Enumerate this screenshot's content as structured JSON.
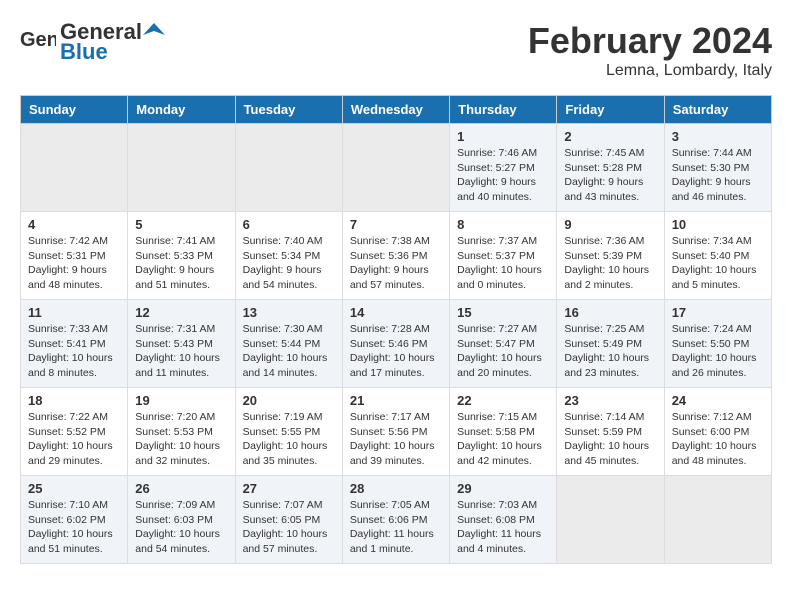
{
  "header": {
    "logo_general": "General",
    "logo_blue": "Blue",
    "month": "February 2024",
    "location": "Lemna, Lombardy, Italy"
  },
  "weekdays": [
    "Sunday",
    "Monday",
    "Tuesday",
    "Wednesday",
    "Thursday",
    "Friday",
    "Saturday"
  ],
  "weeks": [
    [
      {
        "day": "",
        "info": ""
      },
      {
        "day": "",
        "info": ""
      },
      {
        "day": "",
        "info": ""
      },
      {
        "day": "",
        "info": ""
      },
      {
        "day": "1",
        "info": "Sunrise: 7:46 AM\nSunset: 5:27 PM\nDaylight: 9 hours\nand 40 minutes."
      },
      {
        "day": "2",
        "info": "Sunrise: 7:45 AM\nSunset: 5:28 PM\nDaylight: 9 hours\nand 43 minutes."
      },
      {
        "day": "3",
        "info": "Sunrise: 7:44 AM\nSunset: 5:30 PM\nDaylight: 9 hours\nand 46 minutes."
      }
    ],
    [
      {
        "day": "4",
        "info": "Sunrise: 7:42 AM\nSunset: 5:31 PM\nDaylight: 9 hours\nand 48 minutes."
      },
      {
        "day": "5",
        "info": "Sunrise: 7:41 AM\nSunset: 5:33 PM\nDaylight: 9 hours\nand 51 minutes."
      },
      {
        "day": "6",
        "info": "Sunrise: 7:40 AM\nSunset: 5:34 PM\nDaylight: 9 hours\nand 54 minutes."
      },
      {
        "day": "7",
        "info": "Sunrise: 7:38 AM\nSunset: 5:36 PM\nDaylight: 9 hours\nand 57 minutes."
      },
      {
        "day": "8",
        "info": "Sunrise: 7:37 AM\nSunset: 5:37 PM\nDaylight: 10 hours\nand 0 minutes."
      },
      {
        "day": "9",
        "info": "Sunrise: 7:36 AM\nSunset: 5:39 PM\nDaylight: 10 hours\nand 2 minutes."
      },
      {
        "day": "10",
        "info": "Sunrise: 7:34 AM\nSunset: 5:40 PM\nDaylight: 10 hours\nand 5 minutes."
      }
    ],
    [
      {
        "day": "11",
        "info": "Sunrise: 7:33 AM\nSunset: 5:41 PM\nDaylight: 10 hours\nand 8 minutes."
      },
      {
        "day": "12",
        "info": "Sunrise: 7:31 AM\nSunset: 5:43 PM\nDaylight: 10 hours\nand 11 minutes."
      },
      {
        "day": "13",
        "info": "Sunrise: 7:30 AM\nSunset: 5:44 PM\nDaylight: 10 hours\nand 14 minutes."
      },
      {
        "day": "14",
        "info": "Sunrise: 7:28 AM\nSunset: 5:46 PM\nDaylight: 10 hours\nand 17 minutes."
      },
      {
        "day": "15",
        "info": "Sunrise: 7:27 AM\nSunset: 5:47 PM\nDaylight: 10 hours\nand 20 minutes."
      },
      {
        "day": "16",
        "info": "Sunrise: 7:25 AM\nSunset: 5:49 PM\nDaylight: 10 hours\nand 23 minutes."
      },
      {
        "day": "17",
        "info": "Sunrise: 7:24 AM\nSunset: 5:50 PM\nDaylight: 10 hours\nand 26 minutes."
      }
    ],
    [
      {
        "day": "18",
        "info": "Sunrise: 7:22 AM\nSunset: 5:52 PM\nDaylight: 10 hours\nand 29 minutes."
      },
      {
        "day": "19",
        "info": "Sunrise: 7:20 AM\nSunset: 5:53 PM\nDaylight: 10 hours\nand 32 minutes."
      },
      {
        "day": "20",
        "info": "Sunrise: 7:19 AM\nSunset: 5:55 PM\nDaylight: 10 hours\nand 35 minutes."
      },
      {
        "day": "21",
        "info": "Sunrise: 7:17 AM\nSunset: 5:56 PM\nDaylight: 10 hours\nand 39 minutes."
      },
      {
        "day": "22",
        "info": "Sunrise: 7:15 AM\nSunset: 5:58 PM\nDaylight: 10 hours\nand 42 minutes."
      },
      {
        "day": "23",
        "info": "Sunrise: 7:14 AM\nSunset: 5:59 PM\nDaylight: 10 hours\nand 45 minutes."
      },
      {
        "day": "24",
        "info": "Sunrise: 7:12 AM\nSunset: 6:00 PM\nDaylight: 10 hours\nand 48 minutes."
      }
    ],
    [
      {
        "day": "25",
        "info": "Sunrise: 7:10 AM\nSunset: 6:02 PM\nDaylight: 10 hours\nand 51 minutes."
      },
      {
        "day": "26",
        "info": "Sunrise: 7:09 AM\nSunset: 6:03 PM\nDaylight: 10 hours\nand 54 minutes."
      },
      {
        "day": "27",
        "info": "Sunrise: 7:07 AM\nSunset: 6:05 PM\nDaylight: 10 hours\nand 57 minutes."
      },
      {
        "day": "28",
        "info": "Sunrise: 7:05 AM\nSunset: 6:06 PM\nDaylight: 11 hours\nand 1 minute."
      },
      {
        "day": "29",
        "info": "Sunrise: 7:03 AM\nSunset: 6:08 PM\nDaylight: 11 hours\nand 4 minutes."
      },
      {
        "day": "",
        "info": ""
      },
      {
        "day": "",
        "info": ""
      }
    ]
  ]
}
